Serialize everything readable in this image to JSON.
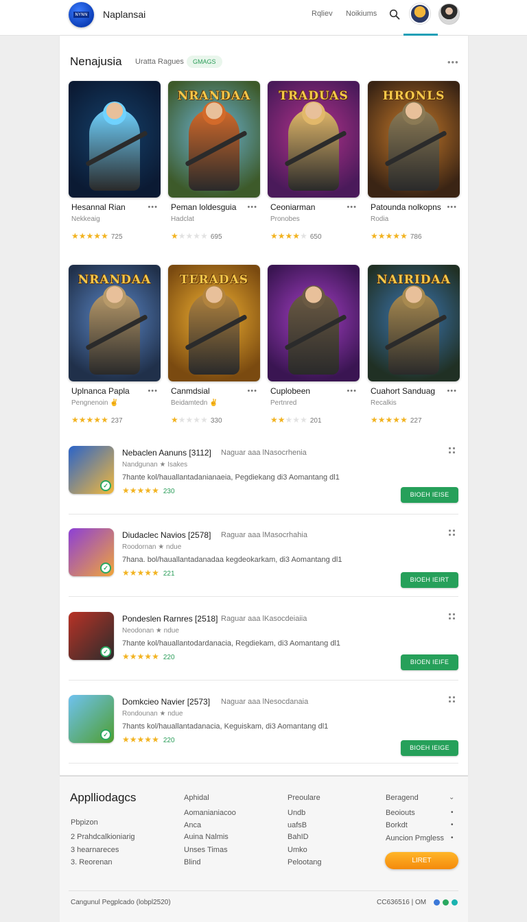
{
  "header": {
    "logo_text": "NYNN",
    "brand": "Naplansai",
    "nav": [
      "Rqliev",
      "Noikiums"
    ]
  },
  "section": {
    "title": "Nenajusia",
    "subtitle": "Uratta Ragues",
    "badge": "GMAGS",
    "more": "•••"
  },
  "tiles": [
    {
      "name": "Hesannal Rian",
      "category": "Nekkeaig",
      "rating": 5,
      "count": "725",
      "banner": "",
      "bg1": "#15416b",
      "bg2": "#0b1a33",
      "accent": "#6fd2ff"
    },
    {
      "name": "Peman loldesguia",
      "category": "Hadclat",
      "rating": 1,
      "count": "695",
      "banner": "NRANDAA",
      "bg1": "#6db5d8",
      "bg2": "#3d5a2a",
      "accent": "#d36a2a"
    },
    {
      "name": "Ceoniarman",
      "category": "Pronobes",
      "rating": 4,
      "count": "650",
      "banner": "TRADUAS",
      "bg1": "#b3338b",
      "bg2": "#4a1a5a",
      "accent": "#e2b86a"
    },
    {
      "name": "Patounda nolkopns",
      "category": "Rodia",
      "rating": 5,
      "count": "786",
      "banner": "HRONLS",
      "bg1": "#c77a2a",
      "bg2": "#3a2414",
      "accent": "#8b7a55"
    },
    {
      "name": "Uplnanca Papla",
      "category": "Pengnenoin ✌",
      "rating": 5,
      "count": "237",
      "banner": "NRANDAA",
      "bg1": "#5b87c7",
      "bg2": "#20304a",
      "accent": "#b89a6a"
    },
    {
      "name": "Canmdsial",
      "category": "Beidamtedn ✌",
      "rating": 1,
      "count": "330",
      "banner": "TERADAS",
      "bg1": "#f2b232",
      "bg2": "#7a4a10",
      "accent": "#b2843f"
    },
    {
      "name": "Cuplobeen",
      "category": "Pertnred",
      "rating": 2,
      "count": "201",
      "banner": "",
      "bg1": "#a43fc4",
      "bg2": "#3a1552",
      "accent": "#6b5a43"
    },
    {
      "name": "Cuahort Sanduag",
      "category": "Recalkis",
      "rating": 5,
      "count": "227",
      "banner": "NAIRIDAA",
      "bg1": "#3c77b4",
      "bg2": "#203024",
      "accent": "#a88a50"
    }
  ],
  "list": [
    {
      "title": "Nebaclen Aanuns [3112]",
      "meta": "Naguar aaa  lNasocrhenia",
      "sub": "Nandgunan ★ Isakes",
      "desc": "7hante kol/hauallantadanianaeia, Pegdiekang di3 Aomantang dl1",
      "stars": 5,
      "count": "230",
      "button": "BIOEH IEISE",
      "icon_bg1": "#2a63c9",
      "icon_bg2": "#f3b93b"
    },
    {
      "title": "Diudaclec Navios [2578]",
      "meta": "Raguar aaa  lMasocrhahia",
      "sub": "Roodornan ★ ndue",
      "desc": "7hana. bol/hauallantadanadaa kegdeokarkam, di3 Aomantang dl1",
      "stars": 5,
      "count": "221",
      "button": "BIOEH IEIRT",
      "icon_bg1": "#8c3fd6",
      "icon_bg2": "#f0a53a"
    },
    {
      "title": "Pondeslen Rarnres [2518]",
      "meta": "Raguar aaa  lKasocdeiaiia",
      "sub": "Neodonan ★ ndue",
      "desc": "7hante kol/hauallantodardanacia, Regdiekam, di3 Aomantang dl1",
      "stars": 5,
      "count": "220",
      "button": "BIOEN IEIFE",
      "icon_bg1": "#b83226",
      "icon_bg2": "#2c2c2c"
    },
    {
      "title": "Domkcieo Navier [2573]",
      "meta": "Naguar aaa  lNesocdanaia",
      "sub": "Rondounan ★ ndue",
      "desc": "7hants kol/hauallantadanacia, Keguiskam, di3 Aomantang dl1",
      "stars": 5,
      "count": "220",
      "button": "BIOEH IEIGE",
      "icon_bg1": "#6fc2f0",
      "icon_bg2": "#4f9e2f"
    }
  ],
  "footer": {
    "title": "Applliodagcs",
    "left_items": [
      "Pbpizon",
      "2 Prahdcalkioniarig",
      "3 hearnareces",
      "3. Reorenan"
    ],
    "col2_head": "Aphidal",
    "col2": [
      "Aomanianiacoo",
      "Anca",
      "Auina Nalmis",
      "Unses Timas",
      "Blind"
    ],
    "col3_head": "Preoulare",
    "col3": [
      "Undb",
      "uafsB",
      "BahID",
      "Umko",
      "Pelootang"
    ],
    "col4_head": "Beragend",
    "col4": [
      "Beoiouts",
      "Borkdt",
      "Auncion Pmgless"
    ],
    "cta": "LIRET",
    "copyright": "Cangunul Pegplcado (lobpl2520)",
    "version": "CC636516  |  OM"
  },
  "colors": {
    "accent_green": "#26a05a",
    "star": "#f2b321",
    "cta_orange": "#f48a0c",
    "underline_teal": "#1aa0b8"
  }
}
